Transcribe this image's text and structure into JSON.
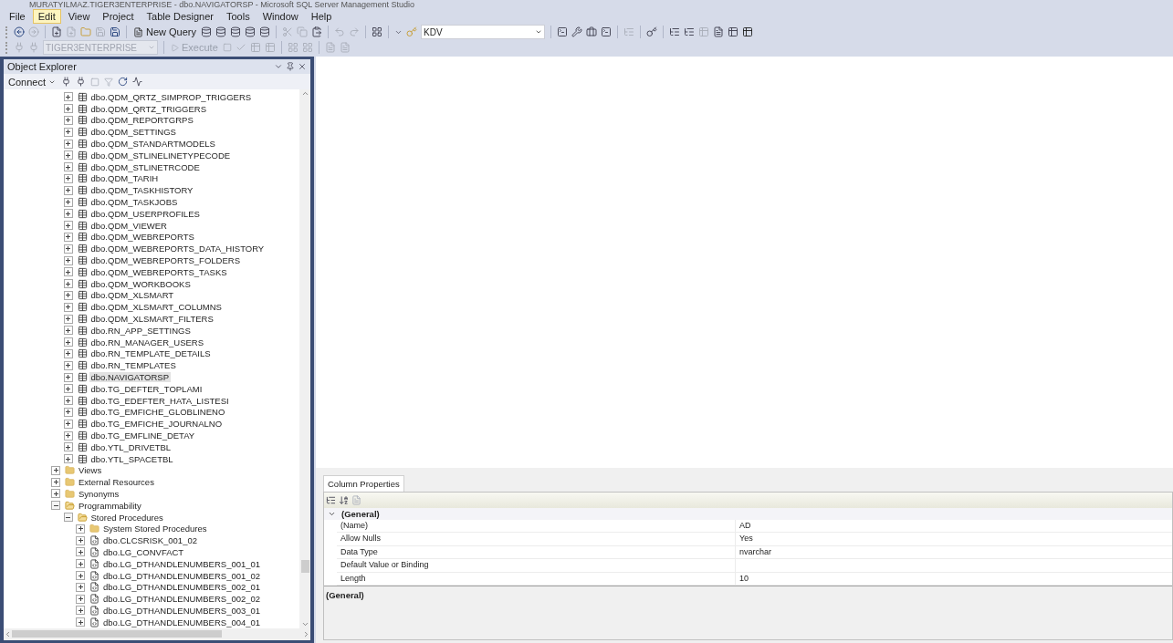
{
  "window": {
    "title": "MURATYILMAZ.TIGER3ENTERPRISE - dbo.NAVIGATORSP - Microsoft SQL Server Management Studio"
  },
  "menu": [
    {
      "label": "File",
      "selected": false
    },
    {
      "label": "Edit",
      "selected": true
    },
    {
      "label": "View",
      "selected": false
    },
    {
      "label": "Project",
      "selected": false
    },
    {
      "label": "Table Designer",
      "selected": false
    },
    {
      "label": "Tools",
      "selected": false
    },
    {
      "label": "Window",
      "selected": false
    },
    {
      "label": "Help",
      "selected": false
    }
  ],
  "toolbar": {
    "new_query": "New Query",
    "database": "KDV"
  },
  "sql_toolbar": {
    "server": "TIGER3ENTERPRISE",
    "execute": "Execute"
  },
  "object_explorer": {
    "title": "Object Explorer",
    "connect": "Connect",
    "tree": [
      {
        "kind": "group",
        "children": [
          {
            "label": "dbo.QDM_QRTZ_SIMPROP_TRIGGERS",
            "kind": "table",
            "expanded": false,
            "selected": false
          },
          {
            "label": "dbo.QDM_QRTZ_TRIGGERS",
            "kind": "table",
            "expanded": false,
            "selected": false
          },
          {
            "label": "dbo.QDM_REPORTGRPS",
            "kind": "table",
            "expanded": false,
            "selected": false
          },
          {
            "label": "dbo.QDM_SETTINGS",
            "kind": "table",
            "expanded": false,
            "selected": false
          },
          {
            "label": "dbo.QDM_STANDARTMODELS",
            "kind": "table",
            "expanded": false,
            "selected": false
          },
          {
            "label": "dbo.QDM_STLINELINETYPECODE",
            "kind": "table",
            "expanded": false,
            "selected": false
          },
          {
            "label": "dbo.QDM_STLINETRCODE",
            "kind": "table",
            "expanded": false,
            "selected": false
          },
          {
            "label": "dbo.QDM_TARIH",
            "kind": "table",
            "expanded": false,
            "selected": false
          },
          {
            "label": "dbo.QDM_TASKHISTORY",
            "kind": "table",
            "expanded": false,
            "selected": false
          },
          {
            "label": "dbo.QDM_TASKJOBS",
            "kind": "table",
            "expanded": false,
            "selected": false
          },
          {
            "label": "dbo.QDM_USERPROFILES",
            "kind": "table",
            "expanded": false,
            "selected": false
          },
          {
            "label": "dbo.QDM_VIEWER",
            "kind": "table",
            "expanded": false,
            "selected": false
          },
          {
            "label": "dbo.QDM_WEBREPORTS",
            "kind": "table",
            "expanded": false,
            "selected": false
          },
          {
            "label": "dbo.QDM_WEBREPORTS_DATA_HISTORY",
            "kind": "table",
            "expanded": false,
            "selected": false
          },
          {
            "label": "dbo.QDM_WEBREPORTS_FOLDERS",
            "kind": "table",
            "expanded": false,
            "selected": false
          },
          {
            "label": "dbo.QDM_WEBREPORTS_TASKS",
            "kind": "table",
            "expanded": false,
            "selected": false
          },
          {
            "label": "dbo.QDM_WORKBOOKS",
            "kind": "table",
            "expanded": false,
            "selected": false
          },
          {
            "label": "dbo.QDM_XLSMART",
            "kind": "table",
            "expanded": false,
            "selected": false
          },
          {
            "label": "dbo.QDM_XLSMART_COLUMNS",
            "kind": "table",
            "expanded": false,
            "selected": false
          },
          {
            "label": "dbo.QDM_XLSMART_FILTERS",
            "kind": "table",
            "expanded": false,
            "selected": false
          },
          {
            "label": "dbo.RN_APP_SETTINGS",
            "kind": "table",
            "expanded": false,
            "selected": false
          },
          {
            "label": "dbo.RN_MANAGER_USERS",
            "kind": "table",
            "expanded": false,
            "selected": false
          },
          {
            "label": "dbo.RN_TEMPLATE_DETAILS",
            "kind": "table",
            "expanded": false,
            "selected": false
          },
          {
            "label": "dbo.RN_TEMPLATES",
            "kind": "table",
            "expanded": false,
            "selected": false
          },
          {
            "label": "dbo.NAVIGATORSP",
            "kind": "table",
            "expanded": false,
            "selected": true
          },
          {
            "label": "dbo.TG_DEFTER_TOPLAMI",
            "kind": "table",
            "expanded": false,
            "selected": false
          },
          {
            "label": "dbo.TG_EDEFTER_HATA_LISTESI",
            "kind": "table",
            "expanded": false,
            "selected": false
          },
          {
            "label": "dbo.TG_EMFICHE_GLOBLINENO",
            "kind": "table",
            "expanded": false,
            "selected": false
          },
          {
            "label": "dbo.TG_EMFICHE_JOURNALNO",
            "kind": "table",
            "expanded": false,
            "selected": false
          },
          {
            "label": "dbo.TG_EMFLINE_DETAY",
            "kind": "table",
            "expanded": false,
            "selected": false
          },
          {
            "label": "dbo.YTL_DRIVETBL",
            "kind": "table",
            "expanded": false,
            "selected": false
          },
          {
            "label": "dbo.YTL_SPACETBL",
            "kind": "table",
            "expanded": false,
            "selected": false
          }
        ]
      },
      {
        "label": "Views",
        "kind": "folder",
        "expanded": false,
        "selected": false
      },
      {
        "label": "External Resources",
        "kind": "folder",
        "expanded": false,
        "selected": false
      },
      {
        "label": "Synonyms",
        "kind": "folder",
        "expanded": false,
        "selected": false
      },
      {
        "label": "Programmability",
        "kind": "folder",
        "expanded": true,
        "selected": false,
        "children": [
          {
            "label": "Stored Procedures",
            "kind": "folder",
            "expanded": true,
            "selected": false,
            "children": [
              {
                "label": "System Stored Procedures",
                "kind": "folder",
                "expanded": false,
                "selected": false
              },
              {
                "label": "dbo.CLCSRISK_001_02",
                "kind": "procedure",
                "expanded": false,
                "selected": false
              },
              {
                "label": "dbo.LG_CONVFACT",
                "kind": "procedure",
                "expanded": false,
                "selected": false
              },
              {
                "label": "dbo.LG_DTHANDLENUMBERS_001_01",
                "kind": "procedure",
                "expanded": false,
                "selected": false
              },
              {
                "label": "dbo.LG_DTHANDLENUMBERS_001_02",
                "kind": "procedure",
                "expanded": false,
                "selected": false
              },
              {
                "label": "dbo.LG_DTHANDLENUMBERS_002_01",
                "kind": "procedure",
                "expanded": false,
                "selected": false
              },
              {
                "label": "dbo.LG_DTHANDLENUMBERS_002_02",
                "kind": "procedure",
                "expanded": false,
                "selected": false
              },
              {
                "label": "dbo.LG_DTHANDLENUMBERS_003_01",
                "kind": "procedure",
                "expanded": false,
                "selected": false
              },
              {
                "label": "dbo.LG_DTHANDLENUMBERS_004_01",
                "kind": "procedure",
                "expanded": false,
                "selected": false
              }
            ]
          }
        ]
      }
    ]
  },
  "column_properties": {
    "tab": "Column Properties",
    "group": {
      "label": "(General)",
      "expanded": true
    },
    "rows": [
      {
        "name": "(Name)",
        "value": "AD"
      },
      {
        "name": "Allow Nulls",
        "value": "Yes"
      },
      {
        "name": "Data Type",
        "value": "nvarchar"
      },
      {
        "name": "Default Value or Binding"
      },
      {
        "name": "Length",
        "value": "10"
      }
    ],
    "description": "(General)"
  }
}
